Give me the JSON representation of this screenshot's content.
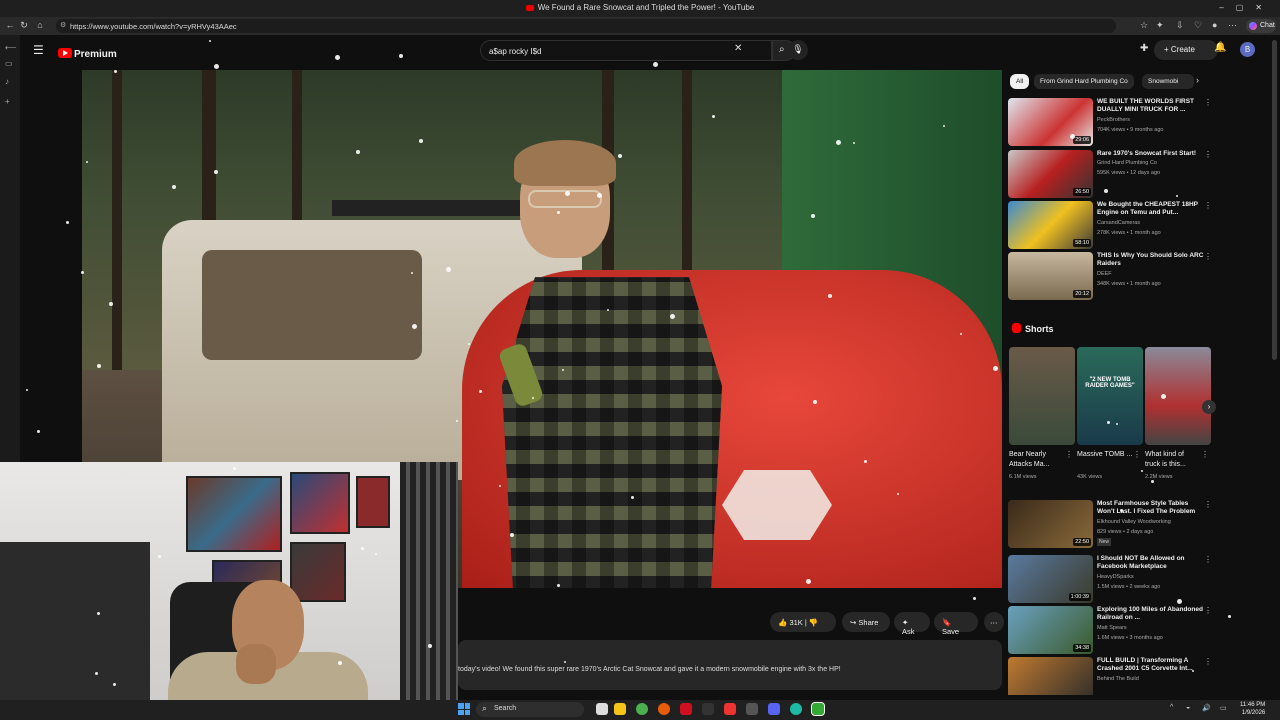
{
  "browser": {
    "window_title": "We Found a Rare Snowcat and Tripled the Power! - YouTube",
    "url": "https://www.youtube.com/watch?v=yRHVy43AAec",
    "chat_label": "Chat"
  },
  "youtube": {
    "logo_text": "Premium",
    "search_value": "a$ap rocky I$d",
    "create_label": "Create",
    "avatar_letter": "B"
  },
  "actions": {
    "like_count": "31K",
    "share_label": "Share",
    "ask_label": "Ask",
    "save_label": "Save"
  },
  "description": {
    "text": "today's video! We found this super rare 1970's Arctic Cat Snowcat and gave it a modern snowmobile engine with 3x the HP!"
  },
  "chips": [
    "All",
    "From Grind Hard Plumbing Co",
    "Snowmobi"
  ],
  "recommendations_top": [
    {
      "title": "WE BUILT THE WORLDS FIRST DUALLY MINI TRUCK FOR ...",
      "channel": "PeckBrothers",
      "meta": "704K views • 9 months ago",
      "duration": "29:06"
    },
    {
      "title": "Rare 1970's Snowcat First Start!",
      "channel": "Grind Hard Plumbing Co",
      "meta": "595K views • 12 days ago",
      "duration": "26:50"
    },
    {
      "title": "We Bought the CHEAPEST 18HP Engine on Temu and Put...",
      "channel": "CarsandCameras",
      "meta": "278K views • 1 month ago",
      "duration": "58:10"
    },
    {
      "title": "THIS Is Why You Should Solo ARC Raiders",
      "channel": "DEEF",
      "meta": "348K views • 1 month ago",
      "duration": "20:12"
    }
  ],
  "shorts": {
    "heading": "Shorts",
    "items": [
      {
        "title": "Bear Nearly Attacks Ma...",
        "views": "6.1M views"
      },
      {
        "title": "Massive TOMB ...",
        "views": "43K views"
      },
      {
        "title": "What kind of truck is this...",
        "views": "2.2M views"
      }
    ],
    "thumb_overlay": "\"2 NEW TOMB RAIDER GAMES\""
  },
  "recommendations_bottom": [
    {
      "title": "Most Farmhouse Style Tables Won't Last. I Fixed The Problem",
      "channel": "Elkhound Valley Woodworking",
      "meta": "829 views • 2 days ago",
      "duration": "22:50",
      "badge": "New"
    },
    {
      "title": "I Should NOT Be Allowed on Facebook Marketplace",
      "channel": "HeavyDSparks",
      "meta": "1.5M views • 2 weeks ago",
      "duration": "1:00:39"
    },
    {
      "title": "Exploring 100 Miles of Abandoned Railroad on ...",
      "channel": "Matt Spears",
      "meta": "1.6M views • 3 months ago",
      "duration": "34:38"
    },
    {
      "title": "FULL BUILD | Transforming A Crashed 2001 C5 Corvette Int...",
      "channel": "Behind The Build",
      "meta": "",
      "duration": ""
    }
  ],
  "taskbar": {
    "search_label": "Search",
    "time": "11:46 PM",
    "date": "1/9/2026"
  },
  "colors": {
    "youtube_red": "#ff0000",
    "background": "#0f0f0f",
    "chip_bg": "#272727"
  }
}
